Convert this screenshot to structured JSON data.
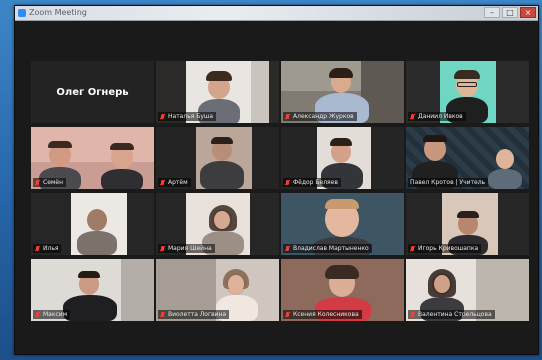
{
  "window": {
    "title": "Zoom Meeting"
  },
  "icons": {
    "app": "zoom-app-icon",
    "muted": "mic-muted-icon"
  },
  "colors": {
    "active_speaker_border": "#f2e600",
    "muted_mic": "#ff3b30",
    "gallery_background": "#1a1a1a"
  },
  "tiles": [
    {
      "display_name": "Олег Огнерь",
      "video_on": false,
      "muted": false
    },
    {
      "name_label": "Наталья Буша",
      "video_on": true,
      "muted": true
    },
    {
      "name_label": "Александр Журков",
      "video_on": true,
      "muted": true
    },
    {
      "name_label": "Даниил Ивков",
      "video_on": true,
      "muted": true
    },
    {
      "name_label": "Семён",
      "video_on": true,
      "muted": true
    },
    {
      "name_label": "Артём",
      "video_on": true,
      "muted": true
    },
    {
      "name_label": "Фёдор Беляев",
      "video_on": true,
      "muted": true
    },
    {
      "name_label": "Павел Кротов | Учитель",
      "video_on": true,
      "muted": false,
      "active_speaker": true
    },
    {
      "name_label": "Илья",
      "video_on": true,
      "muted": true
    },
    {
      "name_label": "Мария Шейна",
      "video_on": true,
      "muted": true
    },
    {
      "name_label": "Владислав Мартыненко",
      "video_on": true,
      "muted": true
    },
    {
      "name_label": "Игорь Кривошапка",
      "video_on": true,
      "muted": true
    },
    {
      "name_label": "Максим",
      "video_on": true,
      "muted": true
    },
    {
      "name_label": "Виолетта Логвина",
      "video_on": true,
      "muted": true
    },
    {
      "name_label": "Ксения Колесникова",
      "video_on": true,
      "muted": true
    },
    {
      "name_label": "Валентина Стрельцова",
      "video_on": true,
      "muted": true
    }
  ]
}
